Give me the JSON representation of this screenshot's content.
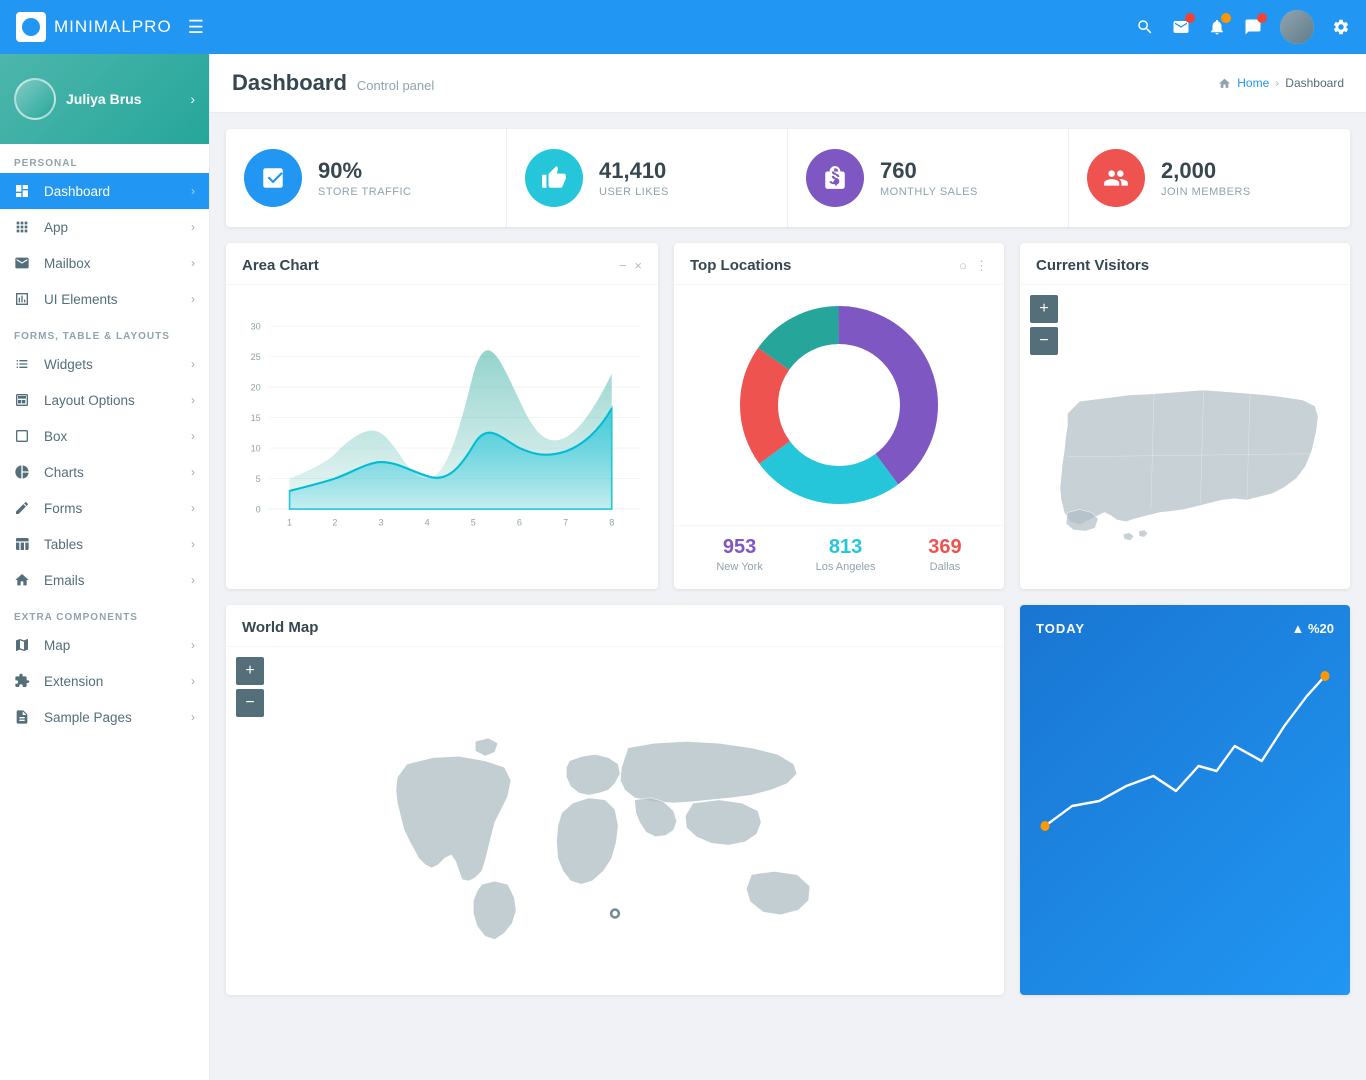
{
  "topbar": {
    "brand": "MINIMALPRO",
    "brand_bold": "MINIMAL",
    "brand_light": "PRO",
    "menu_icon": "☰"
  },
  "sidebar": {
    "user": {
      "name": "Juliya Brus"
    },
    "sections": [
      {
        "label": "PERSONAL",
        "items": [
          {
            "id": "dashboard",
            "label": "Dashboard",
            "icon": "▣",
            "active": true
          },
          {
            "id": "app",
            "label": "App",
            "icon": "⊞"
          },
          {
            "id": "mailbox",
            "label": "Mailbox",
            "icon": "✉"
          },
          {
            "id": "ui-elements",
            "label": "UI Elements",
            "icon": "▭"
          }
        ]
      },
      {
        "label": "FORMS, TABLE & LAYOUTS",
        "items": [
          {
            "id": "widgets",
            "label": "Widgets",
            "icon": "≡"
          },
          {
            "id": "layout-options",
            "label": "Layout Options",
            "icon": "⊡"
          },
          {
            "id": "box",
            "label": "Box",
            "icon": "□"
          },
          {
            "id": "charts",
            "label": "Charts",
            "icon": "◔"
          },
          {
            "id": "forms",
            "label": "Forms",
            "icon": "✎"
          },
          {
            "id": "tables",
            "label": "Tables",
            "icon": "⊞"
          },
          {
            "id": "emails",
            "label": "Emails",
            "icon": "⌂"
          }
        ]
      },
      {
        "label": "EXTRA COMPONENTS",
        "items": [
          {
            "id": "map",
            "label": "Map",
            "icon": "⊕"
          },
          {
            "id": "extension",
            "label": "Extension",
            "icon": "🔧"
          },
          {
            "id": "sample-pages",
            "label": "Sample Pages",
            "icon": "📄"
          }
        ]
      }
    ]
  },
  "page": {
    "title": "Dashboard",
    "subtitle": "Control panel",
    "breadcrumb_home": "Home",
    "breadcrumb_current": "Dashboard"
  },
  "stats": [
    {
      "id": "store-traffic",
      "value": "90%",
      "label": "STORE TRAFFIC",
      "icon": "📊",
      "color": "#2196f3"
    },
    {
      "id": "user-likes",
      "value": "41,410",
      "label": "USER LIKES",
      "icon": "👍",
      "color": "#26c6da"
    },
    {
      "id": "monthly-sales",
      "value": "760",
      "label": "MONTHLY SALES",
      "icon": "🛍",
      "color": "#7e57c2"
    },
    {
      "id": "join-members",
      "value": "2,000",
      "label": "JOIN MEMBERS",
      "icon": "👥",
      "color": "#ef5350"
    }
  ],
  "area_chart": {
    "title": "Area Chart",
    "x_labels": [
      "1",
      "2",
      "3",
      "4",
      "5",
      "6",
      "7",
      "8"
    ],
    "y_labels": [
      "0",
      "5",
      "10",
      "15",
      "20",
      "25",
      "30"
    ],
    "minimize_label": "−",
    "close_label": "×"
  },
  "top_locations": {
    "title": "Top Locations",
    "locations": [
      {
        "city": "New York",
        "value": "953",
        "color": "#7e57c2"
      },
      {
        "city": "Los Angeles",
        "value": "813",
        "color": "#26c6da"
      },
      {
        "city": "Dallas",
        "value": "369",
        "color": "#ef5350"
      }
    ],
    "donut_segments": [
      {
        "color": "#7e57c2",
        "percent": 40
      },
      {
        "color": "#26c6da",
        "percent": 35
      },
      {
        "color": "#ef5350",
        "percent": 15
      },
      {
        "color": "#26a69a",
        "percent": 10
      }
    ]
  },
  "current_visitors": {
    "title": "Current Visitors",
    "zoom_in": "+",
    "zoom_out": "−"
  },
  "world_map": {
    "title": "World Map",
    "zoom_in": "+",
    "zoom_out": "−"
  },
  "today_chart": {
    "title": "TODAY",
    "change": "▲ %20"
  }
}
